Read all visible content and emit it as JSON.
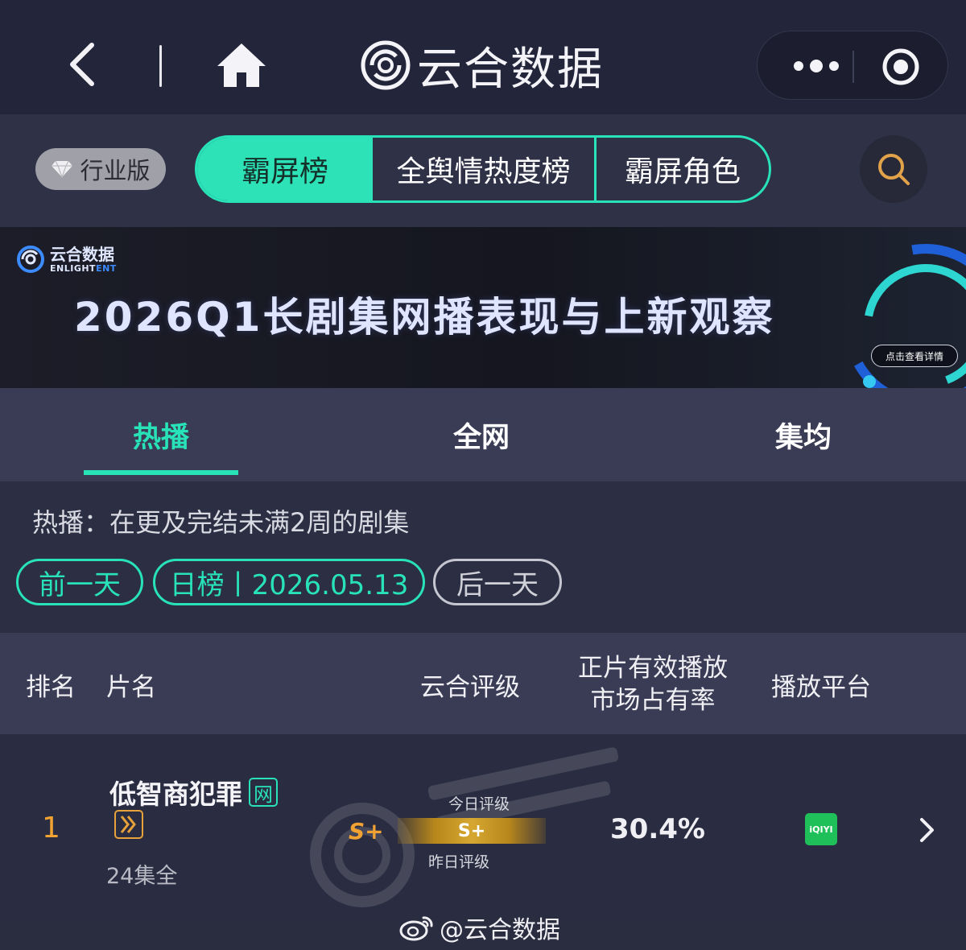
{
  "header": {
    "brand": "云合数据"
  },
  "filters": {
    "industry_label": "行业版",
    "segments": [
      "霸屏榜",
      "全舆情热度榜",
      "霸屏角色"
    ]
  },
  "banner": {
    "logo_cn": "云合数据",
    "logo_en_a": "ENLIGHT",
    "logo_en_b": "ENT",
    "title": "2026Q1长剧集网播表现与上新观察",
    "button": "点击查看详情"
  },
  "tabs": [
    "热播",
    "全网",
    "集均"
  ],
  "content": {
    "description": "热播：在更及完结未满2周的剧集",
    "prev_day": "前一天",
    "date_label": "日榜丨2026.05.13",
    "next_day": "后一天"
  },
  "table": {
    "headers": {
      "rank": "排名",
      "name": "片名",
      "rating": "云合评级",
      "share_line1": "正片有效播放",
      "share_line2": "市场占有率",
      "platform": "播放平台"
    },
    "rows": [
      {
        "rank": "1",
        "title": "低智商犯罪",
        "net_badge": "网",
        "episodes": "24集全",
        "grade": "S+",
        "today_label": "今日评级",
        "bar_grade": "S+",
        "yesterday_label": "昨日评级",
        "share": "30.4%",
        "platform": "iQIYI"
      }
    ]
  },
  "footer": {
    "weibo_handle": "@云合数据"
  },
  "colors": {
    "accent": "#28e3b8",
    "grade": "#f2a133",
    "iqiyi": "#1fbf59"
  }
}
